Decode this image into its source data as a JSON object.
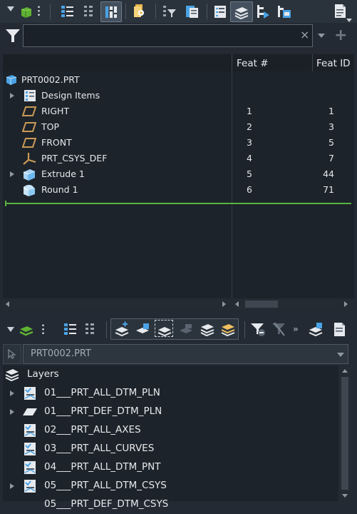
{
  "model_tree": {
    "columns": {
      "feat_num": "Feat #",
      "feat_id": "Feat ID"
    },
    "root": "PRT0002.PRT",
    "rows": [
      {
        "label": "Design Items",
        "num": "",
        "id": ""
      },
      {
        "label": "RIGHT",
        "num": "1",
        "id": "1"
      },
      {
        "label": "TOP",
        "num": "2",
        "id": "3"
      },
      {
        "label": "FRONT",
        "num": "3",
        "id": "5"
      },
      {
        "label": "PRT_CSYS_DEF",
        "num": "4",
        "id": "7"
      },
      {
        "label": "Extrude 1",
        "num": "5",
        "id": "44"
      },
      {
        "label": "Round 1",
        "num": "6",
        "id": "71"
      }
    ]
  },
  "layer_tree": {
    "model_select": "PRT0002.PRT",
    "root": "Layers",
    "items": [
      "01___PRT_ALL_DTM_PLN",
      "01___PRT_DEF_DTM_PLN",
      "02___PRT_ALL_AXES",
      "03___PRT_ALL_CURVES",
      "04___PRT_ALL_DTM_PNT",
      "05___PRT_ALL_DTM_CSYS",
      "05___PRT_DEF_DTM_CSYS"
    ]
  },
  "colors": {
    "accent": "#58b340",
    "panel": "#1d232a",
    "toolbar": "#2a323b"
  }
}
